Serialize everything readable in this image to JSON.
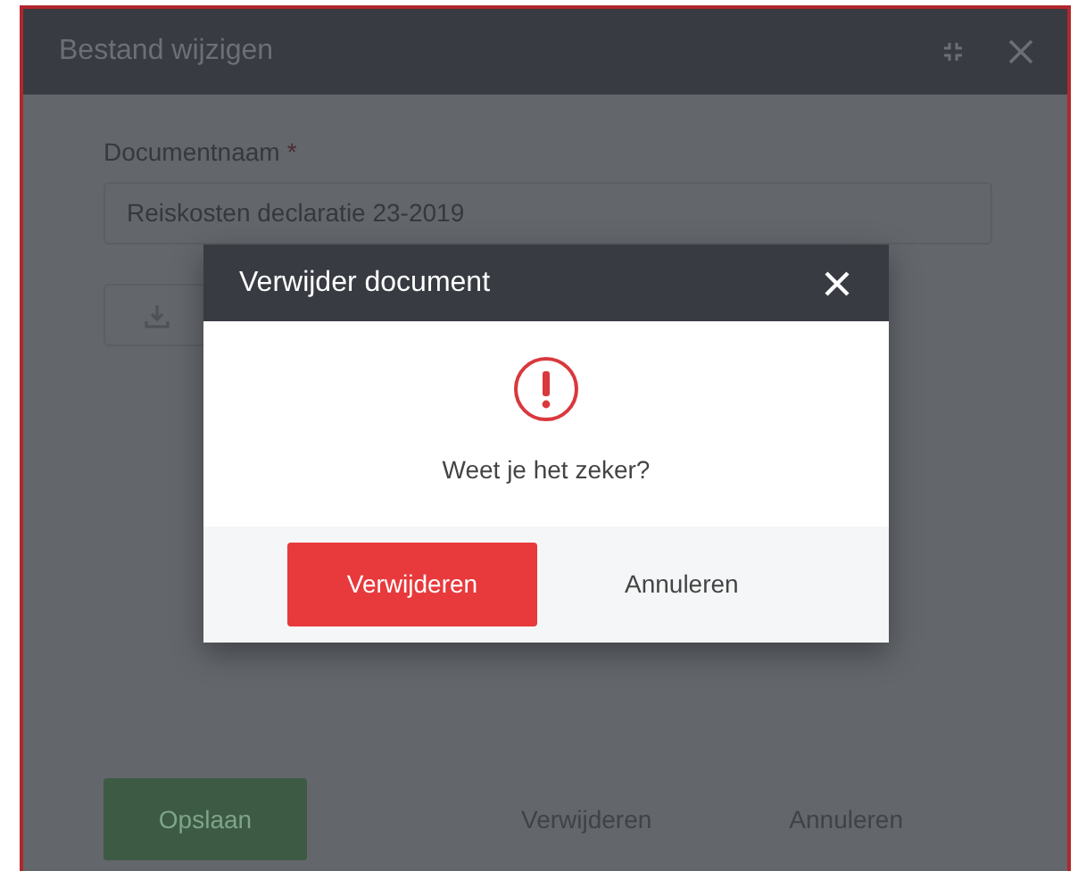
{
  "window": {
    "title": "Bestand wijzigen"
  },
  "form": {
    "label": "Documentnaam",
    "required_mark": "*",
    "value": "Reiskosten declaratie 23-2019"
  },
  "footer_buttons": [
    {
      "label": "Opslaan",
      "kind": "primary"
    },
    {
      "label": "Verwijderen",
      "kind": "text"
    },
    {
      "label": "Annuleren",
      "kind": "text"
    }
  ],
  "dialog": {
    "title": "Verwijder document",
    "message": "Weet je het zeker?",
    "buttons": [
      {
        "label": "Verwijderen",
        "kind": "danger"
      },
      {
        "label": "Annuleren",
        "kind": "text"
      }
    ]
  }
}
